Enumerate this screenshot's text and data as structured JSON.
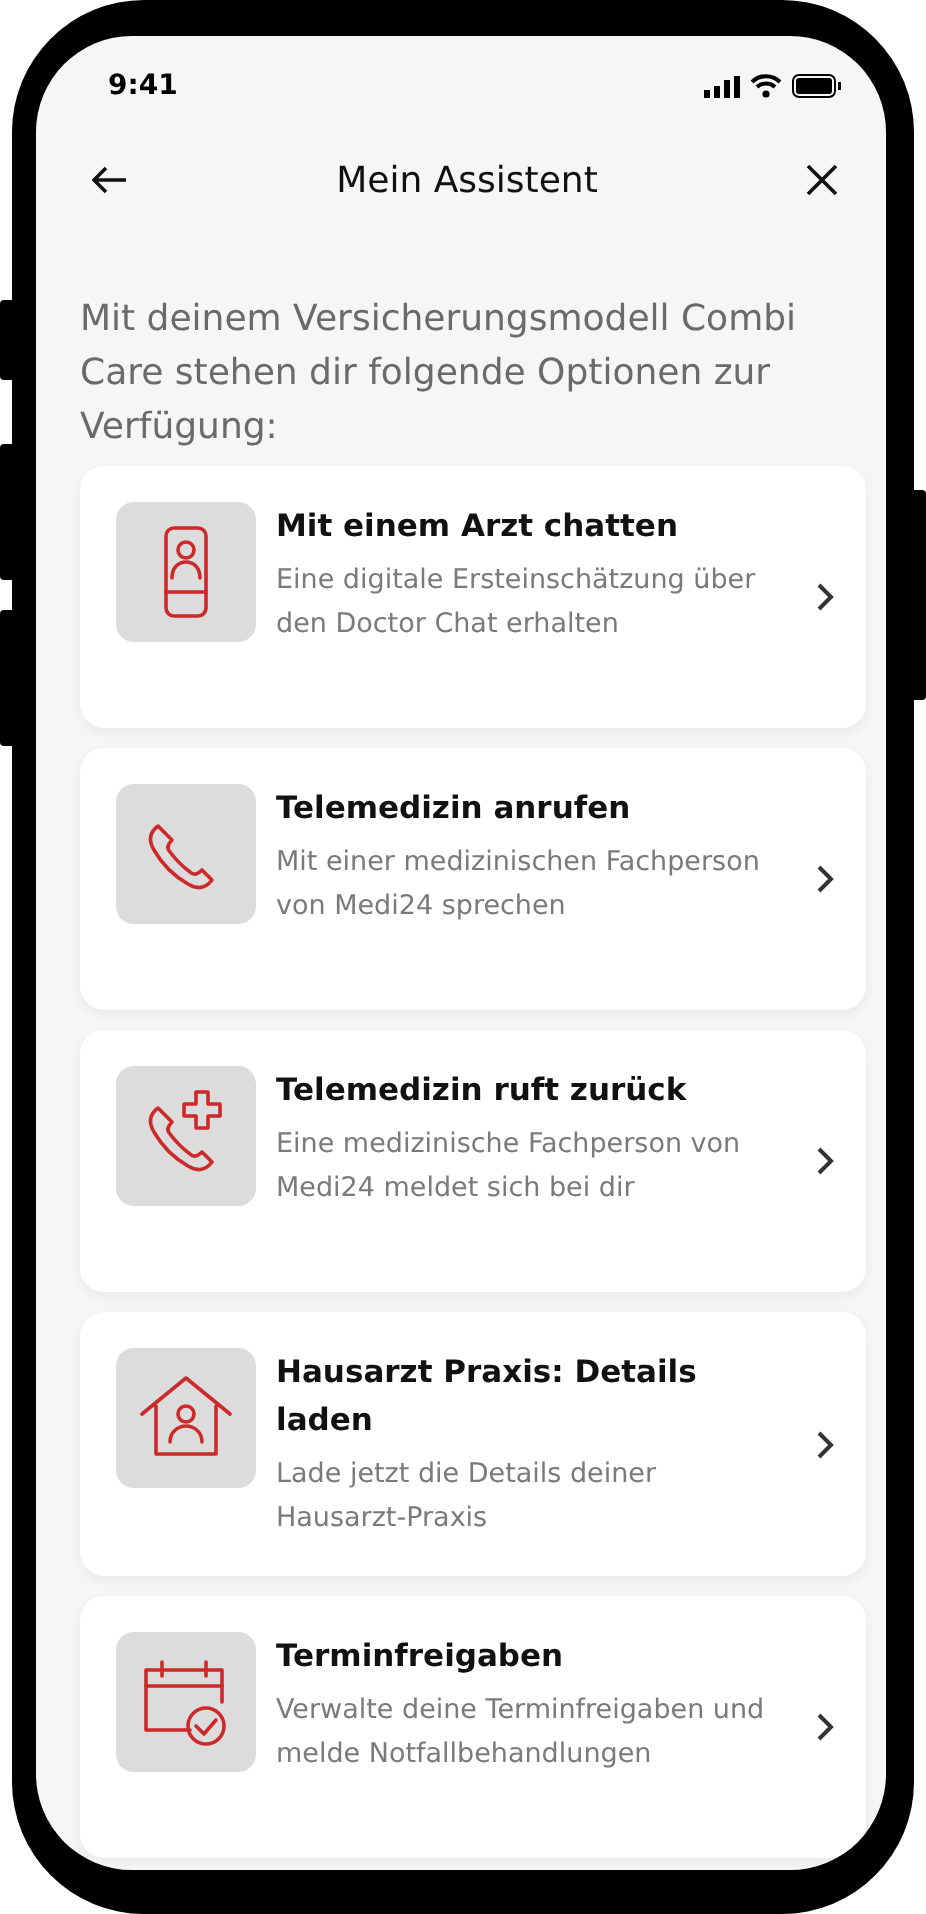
{
  "status_bar": {
    "time": "9:41"
  },
  "header": {
    "title": "Mein Assistent"
  },
  "intro": "Mit deinem Versicherungsmodell Combi Care stehen dir folgende Optionen zur Verfügung:",
  "options": [
    {
      "kind": "doctor-phone",
      "title": "Mit einem Arzt chatten",
      "description": "Eine digitale Ersteinschätzung über den Doctor Chat erhalten"
    },
    {
      "kind": "phone",
      "title": "Telemedizin anrufen",
      "description": "Mit einer medizinischen Fachperson von Medi24 sprechen"
    },
    {
      "kind": "phone-plus",
      "title": "Telemedizin ruft zurück",
      "description": "Eine medizinische Fachperson von Medi24 meldet sich bei dir"
    },
    {
      "kind": "house-doctor",
      "title": "Hausarzt Praxis: Details laden",
      "description": "Lade jetzt die Details deiner Hausarzt-Praxis"
    },
    {
      "kind": "calendar-check",
      "title": "Terminfreigaben",
      "description": "Verwalte deine Terminfreigaben und melde Notfallbehandlungen"
    }
  ]
}
